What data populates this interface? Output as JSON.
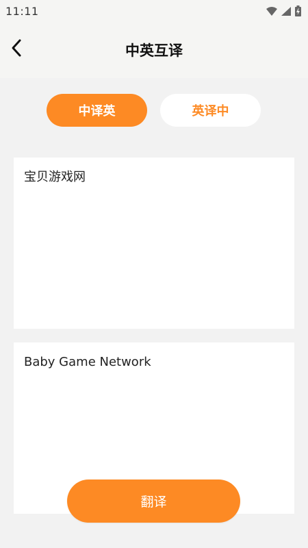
{
  "status_bar": {
    "time": "11:11",
    "icons": [
      "wifi-icon",
      "cell-signal-icon",
      "battery-charging-icon"
    ]
  },
  "header": {
    "back_icon": "chevron-left-icon",
    "title": "中英互译"
  },
  "toggle": {
    "active_label": "中译英",
    "inactive_label": "英译中"
  },
  "input_panel": {
    "text": "宝贝游戏网"
  },
  "output_panel": {
    "text": "Baby Game Network"
  },
  "translate_button": {
    "label": "翻译"
  },
  "colors": {
    "accent": "#fd8a24",
    "background": "#f2f2f2",
    "header_background": "#f5f5f3",
    "panel": "#ffffff"
  }
}
